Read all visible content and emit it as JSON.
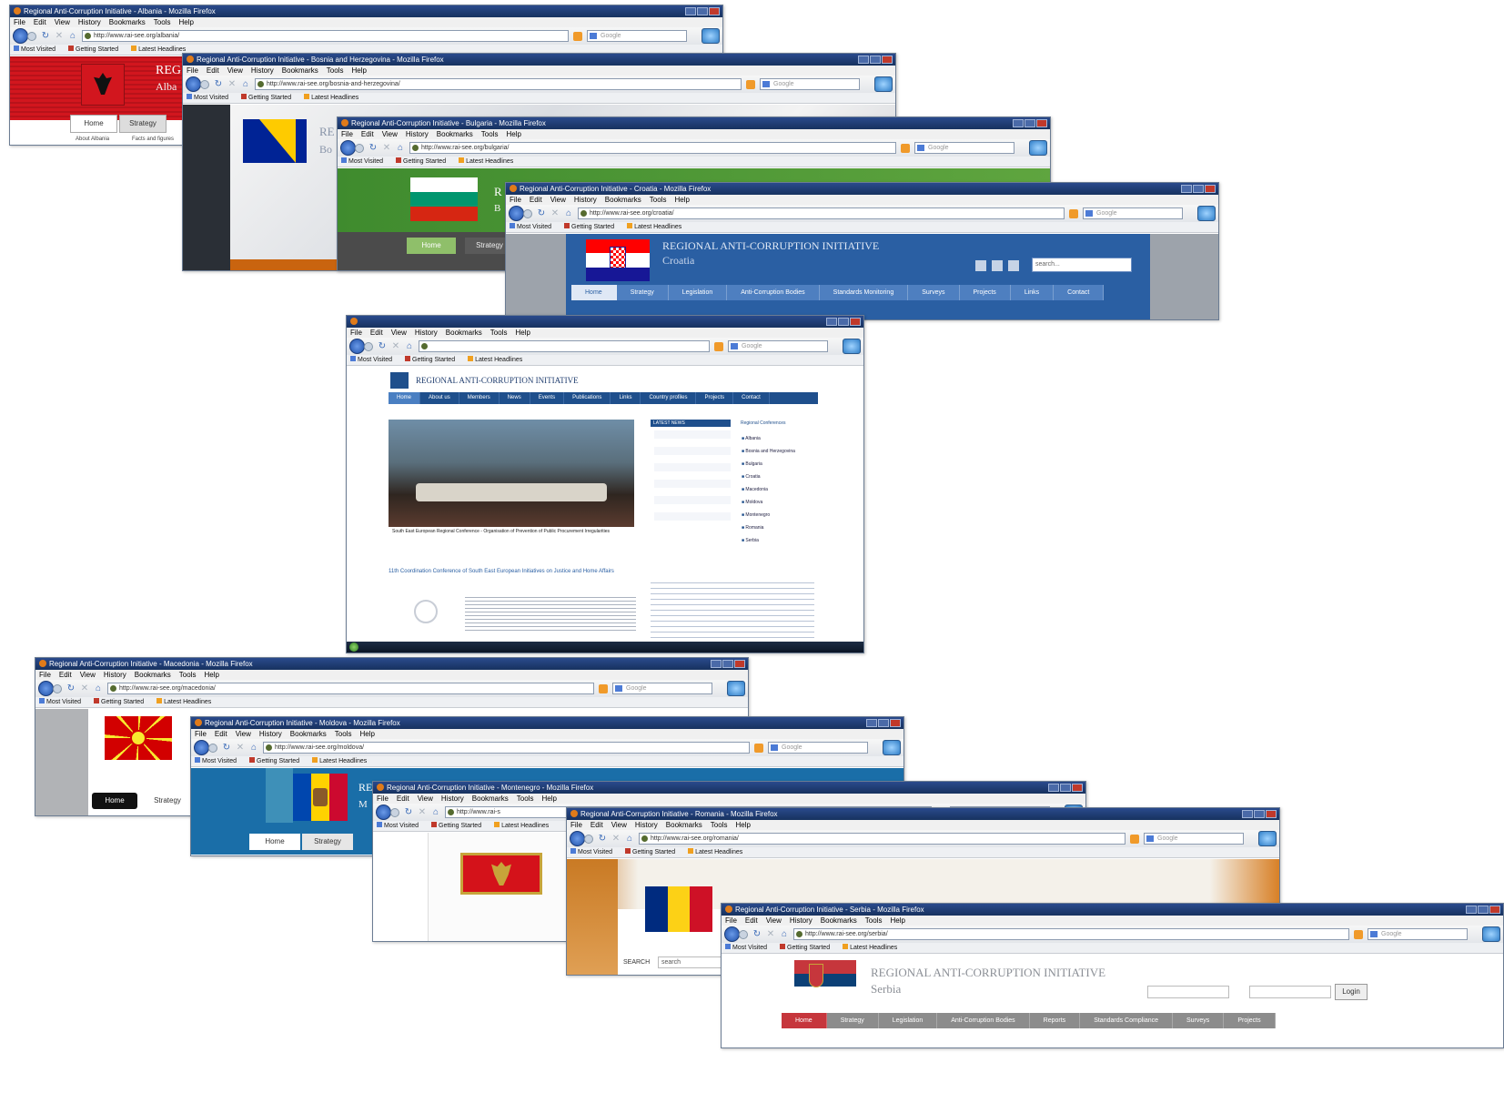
{
  "browser": {
    "menu": [
      "File",
      "Edit",
      "View",
      "History",
      "Bookmarks",
      "Tools",
      "Help"
    ],
    "bookmarks": [
      "Most Visited",
      "Getting Started",
      "Latest Headlines"
    ],
    "search_placeholder": "Google"
  },
  "site": {
    "title": "REGIONAL ANTI-CORRUPTION INITIATIVE"
  },
  "windows": {
    "albania": {
      "title": "Regional Anti-Corruption Initiative - Albania - Mozilla Firefox",
      "url": "http://www.rai-see.org/albania/",
      "title_fragment": "REG",
      "country_fragment": "Alba",
      "tabs": [
        "Home",
        "Strategy"
      ],
      "links": [
        "About Albania",
        "Facts and figures"
      ]
    },
    "bosnia": {
      "title": "Regional Anti-Corruption Initiative - Bosnia and Herzegovina - Mozilla Firefox",
      "url": "http://www.rai-see.org/bosnia-and-herzegovina/",
      "title_fragment": "RE",
      "country_fragment": "Bo"
    },
    "bulgaria": {
      "title": "Regional Anti-Corruption Initiative - Bulgaria - Mozilla Firefox",
      "url": "http://www.rai-see.org/bulgaria/",
      "title_fragment": "R",
      "country_fragment": "B",
      "tabs": [
        "Home",
        "Strategy"
      ]
    },
    "croatia": {
      "title": "Regional Anti-Corruption Initiative - Croatia - Mozilla Firefox",
      "url": "http://www.rai-see.org/croatia/",
      "country": "Croatia",
      "search_placeholder": "search...",
      "tabs": [
        "Home",
        "Strategy",
        "Legislation",
        "Anti-Corruption Bodies",
        "Standards Monitoring",
        "Surveys",
        "Projects",
        "Links",
        "Contact"
      ]
    },
    "main": {
      "nav": [
        "Home",
        "About us",
        "Members",
        "News",
        "Events",
        "Publications",
        "Links",
        "Country profiles",
        "Projects",
        "Contact"
      ],
      "box_latest": "LATEST NEWS",
      "box_conferences": "Regional Conferences",
      "countries": [
        "Albania",
        "Bosnia and Herzegovina",
        "Bulgaria",
        "Croatia",
        "Macedonia",
        "Moldova",
        "Montenegro",
        "Romania",
        "Serbia"
      ],
      "caption": "South East European Regional Conference - Organisation of Prevention of Public Procurement Irregularities",
      "headline": "11th Coordination Conference of South East European Initiatives on Justice and Home Affairs"
    },
    "macedonia": {
      "title": "Regional Anti-Corruption Initiative - Macedonia - Mozilla Firefox",
      "url": "http://www.rai-see.org/macedonia/",
      "tabs": [
        "Home",
        "Strategy"
      ]
    },
    "moldova": {
      "title": "Regional Anti-Corruption Initiative - Moldova - Mozilla Firefox",
      "url": "http://www.rai-see.org/moldova/",
      "title_fragment": "RE",
      "country_fragment": "M",
      "tabs": [
        "Home",
        "Strategy"
      ]
    },
    "montenegro": {
      "title": "Regional Anti-Corruption Initiative - Montenegro - Mozilla Firefox",
      "url": "http://www.rai-s"
    },
    "romania": {
      "title": "Regional Anti-Corruption Initiative - Romania - Mozilla Firefox",
      "url": "http://www.rai-see.org/romania/",
      "search_label": "SEARCH",
      "search_placeholder": "search"
    },
    "serbia": {
      "title": "Regional Anti-Corruption Initiative - Serbia - Mozilla Firefox",
      "url": "http://www.rai-see.org/serbia/",
      "country": "Serbia",
      "login": "Login",
      "tabs": [
        "Home",
        "Strategy",
        "Legislation",
        "Anti-Corruption Bodies",
        "Reports",
        "Standards Compliance",
        "Surveys",
        "Projects"
      ]
    }
  },
  "colors": {
    "titlebar": "#1f3d75",
    "albania_red": "#d2161e",
    "bosnia_blue": "#002395",
    "bosnia_yellow": "#fecb00",
    "bulgaria_green": "#00966e",
    "croatia_blue": "#2a5fa3",
    "main_blue": "#1f4f8c",
    "serbia_red": "#c6363c",
    "romania_yellow": "#fcd116",
    "moldova_bg": "#1a6ea8"
  }
}
